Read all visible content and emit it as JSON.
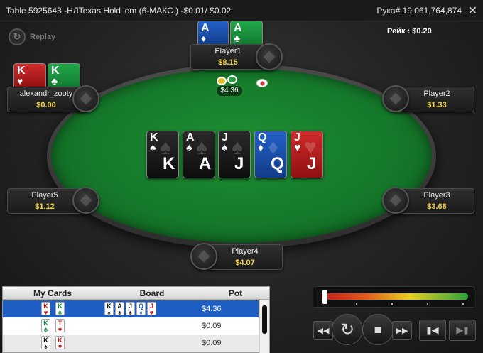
{
  "window": {
    "title": "Table 5925643 -НЛTexas Hold 'em (6-МАКС.) -$0.01/ $0.02",
    "hand_number": "Рука# 19,061,764,874",
    "close_glyph": "✕"
  },
  "replay_label": "Replay",
  "rake": "Рейк : $0.20",
  "players": [
    {
      "name": "Player1",
      "stack": "$8.15"
    },
    {
      "name": "alexandr_zooty",
      "stack": "$0.00"
    },
    {
      "name": "Player2",
      "stack": "$1.33"
    },
    {
      "name": "Player5",
      "stack": "$1.12"
    },
    {
      "name": "Player3",
      "stack": "$3.68"
    },
    {
      "name": "Player4",
      "stack": "$4.07"
    }
  ],
  "player1_cards": [
    {
      "rank": "A",
      "suit": "♦",
      "color": "blue"
    },
    {
      "rank": "A",
      "suit": "♣",
      "color": "green"
    }
  ],
  "hero_cards": [
    {
      "rank": "K",
      "suit": "♥",
      "color": "red"
    },
    {
      "rank": "K",
      "suit": "♣",
      "color": "green"
    }
  ],
  "board": [
    {
      "rank": "K",
      "suit": "♠",
      "color": "black"
    },
    {
      "rank": "A",
      "suit": "♠",
      "color": "black"
    },
    {
      "rank": "J",
      "suit": "♠",
      "color": "black"
    },
    {
      "rank": "Q",
      "suit": "♦",
      "color": "blue"
    },
    {
      "rank": "J",
      "suit": "♥",
      "color": "red"
    }
  ],
  "pot_amount": "$4.36",
  "history": {
    "headers": {
      "my_cards": "My Cards",
      "board": "Board",
      "pot": "Pot"
    },
    "rows": [
      {
        "pot": "$4.36",
        "cards": [
          {
            "r": "K",
            "s": "♥",
            "c": "red"
          },
          {
            "r": "K",
            "s": "♣",
            "c": "green"
          }
        ],
        "board": [
          {
            "r": "K",
            "s": "♠",
            "c": "black"
          },
          {
            "r": "A",
            "s": "♠",
            "c": "black"
          },
          {
            "r": "J",
            "s": "♠",
            "c": "black"
          },
          {
            "r": "Q",
            "s": "♦",
            "c": "blue"
          },
          {
            "r": "J",
            "s": "♥",
            "c": "red"
          }
        ]
      },
      {
        "pot": "$0.09",
        "cards": [
          {
            "r": "K",
            "s": "♣",
            "c": "green"
          },
          {
            "r": "T",
            "s": "♥",
            "c": "red"
          }
        ],
        "board": []
      },
      {
        "pot": "$0.09",
        "cards": [
          {
            "r": "K",
            "s": "♠",
            "c": "black"
          },
          {
            "r": "K",
            "s": "♥",
            "c": "red"
          }
        ],
        "board": []
      }
    ]
  },
  "replay_progress": 0.0,
  "controls": {
    "rewind_icon": "◀◀",
    "replay_icon": "↻",
    "stop_icon": "■",
    "forward_icon": "▶▶",
    "first_icon": "▮◀",
    "next_icon": "▶▮"
  }
}
